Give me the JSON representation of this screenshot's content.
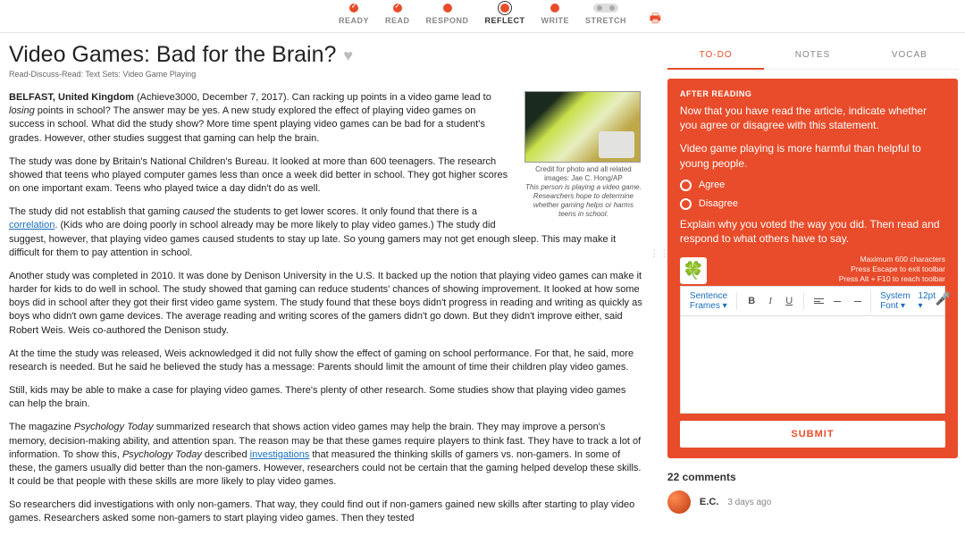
{
  "stepper": {
    "steps": [
      "READY",
      "READ",
      "RESPOND",
      "REFLECT",
      "WRITE",
      "STRETCH"
    ]
  },
  "page": {
    "title": "Video Games: Bad for the Brain?",
    "breadcrumb": "Read-Discuss-Read: Text Sets: Video Game Playing"
  },
  "figure": {
    "credit": "Credit for photo and all related images: Jae C. Hong/AP",
    "caption": "This person is playing a video game. Researchers hope to determine whether gaming helps or harms teens in school."
  },
  "article": {
    "p1a": "BELFAST, United Kingdom ",
    "p1b": "(Achieve3000, December 7, 2017). Can racking up points in a video game lead to ",
    "p1_em": "losing",
    "p1c": " points in school? The answer may be yes. A new study explored the effect of playing video games on success in school. What did the study show? More time spent playing video games can be bad for a student's grades. However, other studies suggest that gaming can help the brain.",
    "p2": "The study was done by Britain's National Children's Bureau. It looked at more than 600 teenagers. The research showed that teens who played computer games less than once a week did better in school. They got higher scores on one important exam. Teens who played twice a day didn't do as well.",
    "p3a": "The study did not establish that gaming ",
    "p3_em": "caused",
    "p3b": " the students to get lower scores. It only found that there is a ",
    "p3_link": "correlation",
    "p3c": ". (Kids who are doing poorly in school already may be more likely to play video games.) The study did suggest, however, that playing video games caused students to stay up late. So young gamers may not get enough sleep. This may make it difficult for them to pay attention in school.",
    "p4": "Another study was completed in 2010. It was done by Denison University in the U.S. It backed up the notion that playing video games can make it harder for kids to do well in school. The study showed that gaming can reduce students' chances of showing improvement. It looked at how some boys did in school after they got their first video game system. The study found that these boys didn't progress in reading and writing as quickly as boys who didn't own game devices. The average reading and writing scores of the gamers didn't go down. But they didn't improve either, said Robert Weis. Weis co-authored the Denison study.",
    "p5": "At the time the study was released, Weis acknowledged it did not fully show the effect of gaming on school performance. For that, he said, more research is needed. But he said he believed the study has a message: Parents should limit the amount of time their children play video games.",
    "p6": "Still, kids may be able to make a case for playing video games. There's plenty of other research. Some studies show that playing video games can help the brain.",
    "p7a": "The magazine ",
    "p7_em1": "Psychology Today",
    "p7b": " summarized research that shows action video games may help the brain. They may improve a person's memory, decision-making ability, and attention span. The reason may be that these games require players to think fast. They have to track a lot of information. To show this, ",
    "p7_em2": "Psychology Today",
    "p7c": " described ",
    "p7_link": "investigations",
    "p7d": " that measured the thinking skills of gamers vs. non-gamers. In some of these, the gamers usually did better than the non-gamers. However, researchers could not be certain that the gaming helped develop these skills. It could be that people with these skills are more likely to play video games.",
    "p8": "So researchers did investigations with only non-gamers. That way, they could find out if non-gamers gained new skills after starting to play video games. Researchers asked some non-gamers to start playing video games. Then they tested"
  },
  "tabs": {
    "todo": "TO-DO",
    "notes": "NOTES",
    "vocab": "VOCAB"
  },
  "task": {
    "after_label": "AFTER READING",
    "instruction": "Now that you have read the article, indicate whether you agree or disagree with this statement.",
    "statement": "Video game playing is more harmful than helpful to young people.",
    "opt_agree": "Agree",
    "opt_disagree": "Disagree",
    "explain": "Explain why you voted the way you did. Then read and respond to what others have to say.",
    "avatar_emoji": "🍀",
    "limits": {
      "chars": "Maximum 600 characters",
      "escape": "Press Escape to exit toolbar",
      "alt": "Press Alt + F10 to reach toolbar"
    }
  },
  "toolbar": {
    "sentence_frames": "Sentence Frames ▾",
    "font": "System Font ▾",
    "size": "12pt ▾"
  },
  "submit_label": "SUBMIT",
  "comments": {
    "header": "22 comments",
    "first_name": "E.C.",
    "first_time": "3 days ago"
  }
}
